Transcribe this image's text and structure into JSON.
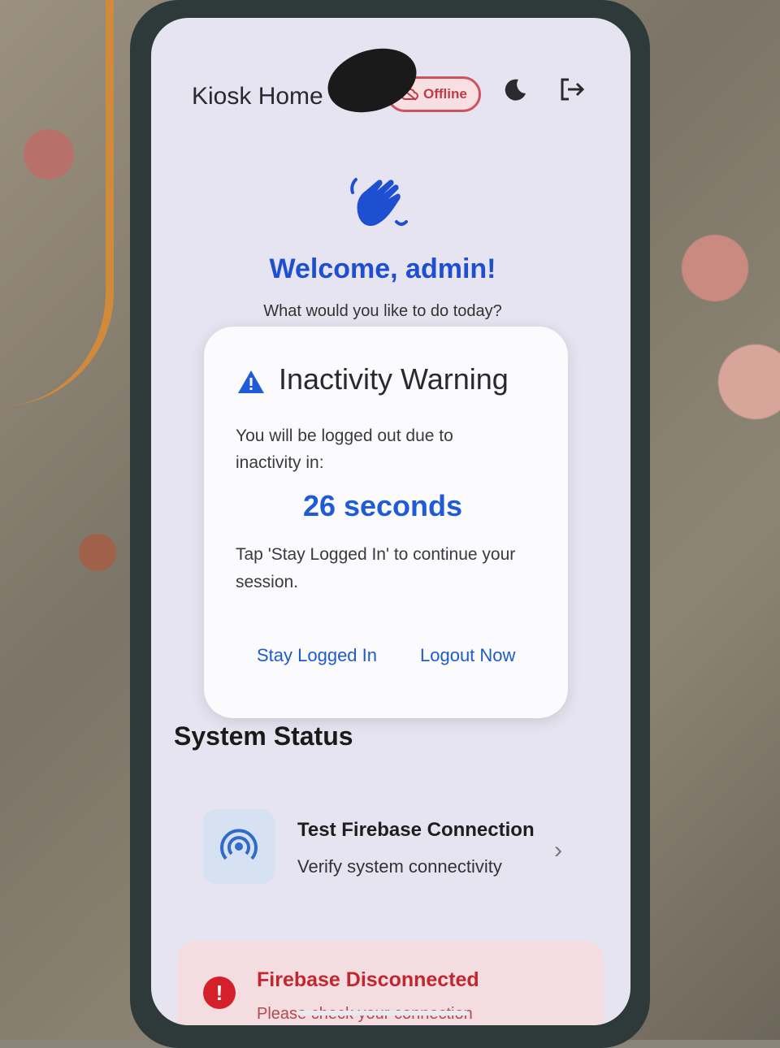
{
  "header": {
    "title": "Kiosk Home",
    "status_chip": "Offline",
    "status_icon": "cloud-off-icon",
    "theme_icon": "moon-icon",
    "logout_icon": "logout-icon"
  },
  "welcome": {
    "icon": "waving-hand-icon",
    "heading": "Welcome, admin!",
    "subtitle": "What would you like to do today?"
  },
  "dialog": {
    "icon": "warning-icon",
    "title": "Inactivity Warning",
    "message": "You will be logged out due to inactivity in:",
    "countdown": "26 seconds",
    "note": "Tap 'Stay Logged In' to continue your session.",
    "primary_button": "Stay Logged In",
    "secondary_button": "Logout Now"
  },
  "system_status": {
    "title": "System Status",
    "test_card": {
      "icon": "wifi-signal-icon",
      "title": "Test Firebase Connection",
      "subtitle": "Verify system connectivity"
    },
    "error_card": {
      "icon": "error-icon",
      "title": "Firebase Disconnected",
      "subtitle": "Please check your connection"
    }
  },
  "colors": {
    "accent": "#1e4fd1",
    "error": "#c2262e",
    "screen_bg": "#e5e4f0"
  }
}
